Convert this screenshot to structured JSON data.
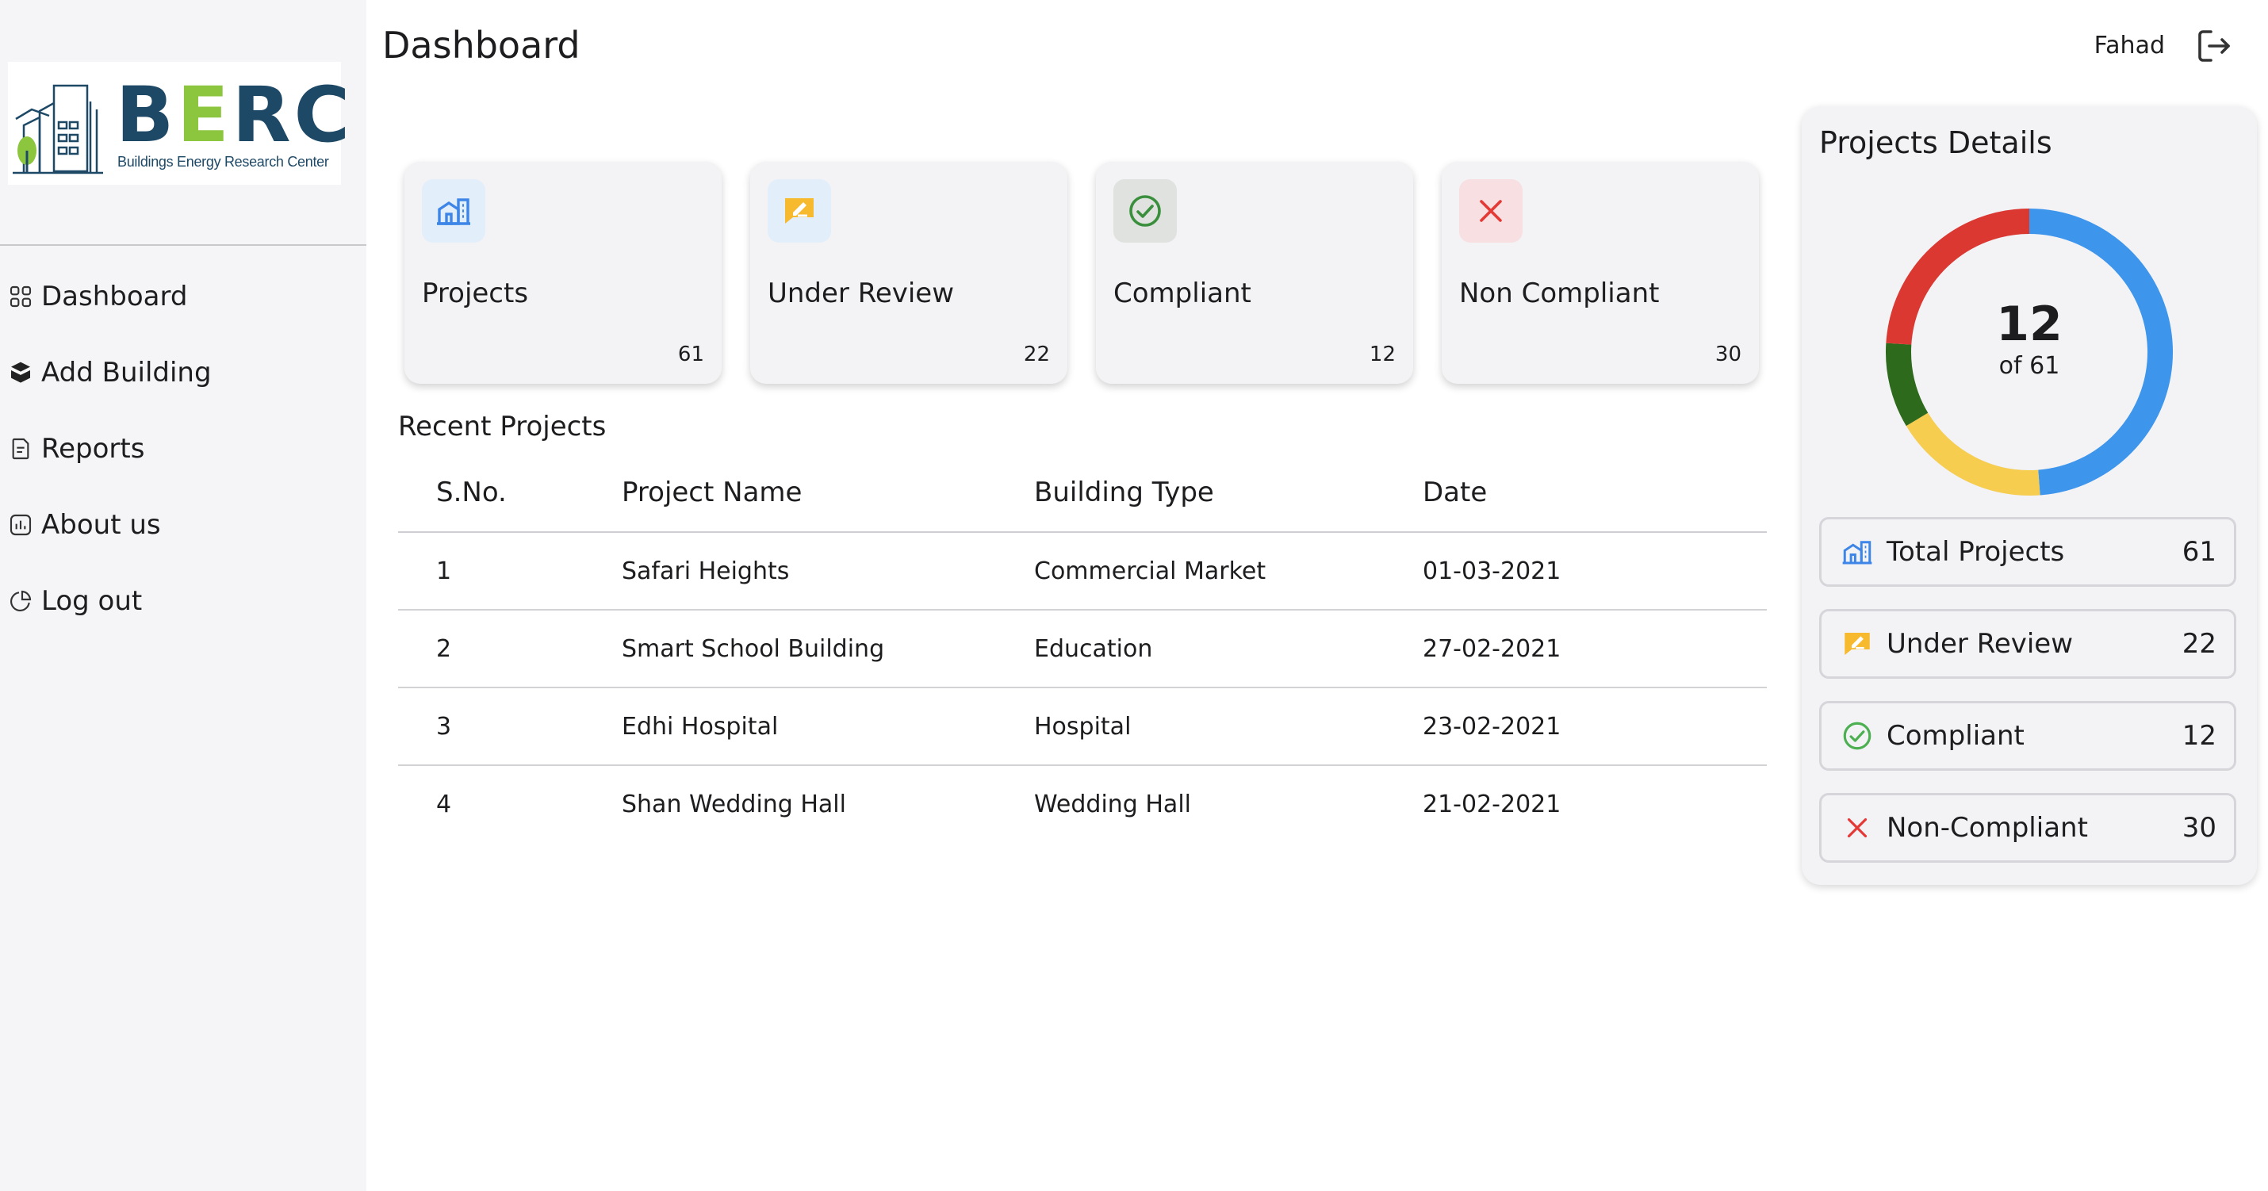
{
  "header": {
    "title": "Dashboard",
    "user": "Fahad"
  },
  "logo": {
    "letters_left": "B",
    "letter_e": "E",
    "letters_right": "RC",
    "tagline": "Buildings Energy Research Center"
  },
  "sidebar": {
    "items": [
      {
        "label": "Dashboard",
        "icon": "grid-icon"
      },
      {
        "label": "Add Building",
        "icon": "box-icon"
      },
      {
        "label": "Reports",
        "icon": "document-icon"
      },
      {
        "label": "About us",
        "icon": "chart-icon"
      },
      {
        "label": "Log out",
        "icon": "pie-icon"
      }
    ]
  },
  "cards": [
    {
      "label": "Projects",
      "count": "61",
      "icon": "building-icon",
      "bg": "#e3eefb"
    },
    {
      "label": "Under Review",
      "count": "22",
      "icon": "review-icon",
      "bg": "#e3eefb"
    },
    {
      "label": "Compliant",
      "count": "12",
      "icon": "check-circle-icon",
      "bg": "#dfe2df"
    },
    {
      "label": "Non Compliant",
      "count": "30",
      "icon": "close-icon",
      "bg": "#f7dfe2"
    }
  ],
  "recent": {
    "title": "Recent Projects",
    "columns": [
      "S.No.",
      "Project Name",
      "Building Type",
      "Date"
    ],
    "rows": [
      [
        "1",
        "Safari Heights",
        "Commercial Market",
        "01-03-2021"
      ],
      [
        "2",
        "Smart School Building",
        "Education",
        "27-02-2021"
      ],
      [
        "3",
        "Edhi Hospital",
        "Hospital",
        "23-02-2021"
      ],
      [
        "4",
        "Shan Wedding Hall",
        "Wedding Hall",
        "21-02-2021"
      ]
    ]
  },
  "panel": {
    "title": "Projects Details",
    "donut": {
      "value": "12",
      "sub": "of 61",
      "segments": [
        {
          "name": "Projects",
          "value": 61,
          "color": "#3d95ec"
        },
        {
          "name": "Under Review",
          "value": 22,
          "color": "#f7cd50"
        },
        {
          "name": "Compliant",
          "value": 12,
          "color": "#2e6a1c"
        },
        {
          "name": "Non Compliant",
          "value": 30,
          "color": "#dc3832"
        }
      ],
      "track_color": "#dde8f6"
    },
    "rows": [
      {
        "label": "Total Projects",
        "value": "61"
      },
      {
        "label": "Under Review",
        "value": "22"
      },
      {
        "label": "Compliant",
        "value": "12"
      },
      {
        "label": "Non-Compliant",
        "value": "30"
      }
    ]
  },
  "colors": {
    "accent_blue": "#3d95ec",
    "review_yellow": "#f7b92d",
    "compliant_green": "#4caf50",
    "noncompliant_red": "#e53935"
  }
}
